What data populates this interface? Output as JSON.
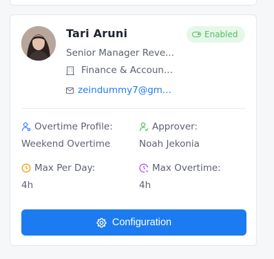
{
  "profile": {
    "name": "Tari Aruni",
    "status": "Enabled",
    "role": "Senior Manager Reve...",
    "department": "Finance & Accoun...",
    "email": "zeindummy7@gm..."
  },
  "details": {
    "overtime_profile_label": "Overtime Profile:",
    "overtime_profile_value": "Weekend Overtime",
    "approver_label": "Approver:",
    "approver_value": "Noah Jekonia",
    "max_per_day_label": "Max Per Day:",
    "max_per_day_value": "4h",
    "max_overtime_label": "Max Overtime:",
    "max_overtime_value": "4h"
  },
  "actions": {
    "configuration_label": "Configuration"
  },
  "icons": {
    "status": "toggle-icon",
    "department": "building-icon",
    "email": "mail-icon",
    "overtime_profile": "user-icon",
    "approver": "user-check-icon",
    "max_per_day": "clock-icon",
    "max_overtime": "clock-alert-icon",
    "configuration": "gear-icon"
  },
  "colors": {
    "accent": "#1c7bf0",
    "success": "#4fbf61",
    "success_bg": "#e6f7e9",
    "overtime_icon": "#3b82f6",
    "approver_icon": "#4fbf61",
    "max_per_day_icon": "#f59e0b",
    "max_overtime_icon": "#a855f7"
  }
}
